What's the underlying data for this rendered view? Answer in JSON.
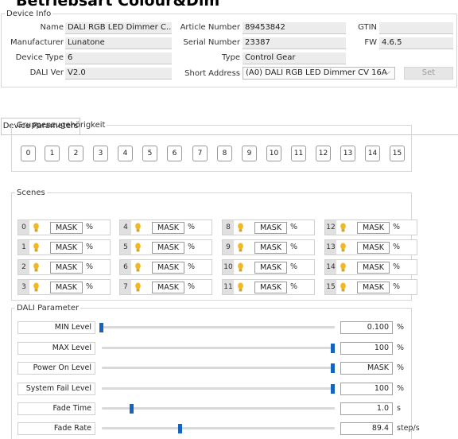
{
  "page_title": "Betriebsart Colour&Dim",
  "device_info": {
    "legend": "Device Info",
    "name_label": "Name",
    "name_value": "DALI RGB LED Dimmer C...",
    "manufacturer_label": "Manufacturer",
    "manufacturer_value": "Lunatone",
    "device_type_label": "Device Type",
    "device_type_value": "6",
    "dali_ver_label": "DALI Ver",
    "dali_ver_value": "V2.0",
    "article_label": "Article Number",
    "article_value": "89453842",
    "serial_label": "Serial Number",
    "serial_value": "23387",
    "type_label": "Type",
    "type_value": "Control Gear",
    "short_address_label": "Short Address",
    "short_address_value": "(A0) DALI RGB LED Dimmer CV 16A",
    "gtin_label": "GTIN",
    "gtin_value": "",
    "fw_label": "FW",
    "fw_value": "4.6.5",
    "set_button": "Set"
  },
  "tab": "Device Parameters",
  "groups": {
    "legend": "Gruppenzugehörigkeit",
    "buttons": [
      "0",
      "1",
      "2",
      "3",
      "4",
      "5",
      "6",
      "7",
      "8",
      "9",
      "10",
      "11",
      "12",
      "13",
      "14",
      "15"
    ]
  },
  "scenes": {
    "legend": "Scenes",
    "items": [
      {
        "num": "0",
        "value": "MASK",
        "unit": "%"
      },
      {
        "num": "1",
        "value": "MASK",
        "unit": "%"
      },
      {
        "num": "2",
        "value": "MASK",
        "unit": "%"
      },
      {
        "num": "3",
        "value": "MASK",
        "unit": "%"
      },
      {
        "num": "4",
        "value": "MASK",
        "unit": "%"
      },
      {
        "num": "5",
        "value": "MASK",
        "unit": "%"
      },
      {
        "num": "6",
        "value": "MASK",
        "unit": "%"
      },
      {
        "num": "7",
        "value": "MASK",
        "unit": "%"
      },
      {
        "num": "8",
        "value": "MASK",
        "unit": "%"
      },
      {
        "num": "9",
        "value": "MASK",
        "unit": "%"
      },
      {
        "num": "10",
        "value": "MASK",
        "unit": "%"
      },
      {
        "num": "11",
        "value": "MASK",
        "unit": "%"
      },
      {
        "num": "12",
        "value": "MASK",
        "unit": "%"
      },
      {
        "num": "13",
        "value": "MASK",
        "unit": "%"
      },
      {
        "num": "14",
        "value": "MASK",
        "unit": "%"
      },
      {
        "num": "15",
        "value": "MASK",
        "unit": "%"
      }
    ]
  },
  "dali_params": {
    "legend": "DALI Parameter",
    "rows": [
      {
        "label": "MIN Level",
        "value": "0.100",
        "unit": "%",
        "slider_level": 0.0
      },
      {
        "label": "MAX Level",
        "value": "100",
        "unit": "%",
        "slider_level": 1.0
      },
      {
        "label": "Power On Level",
        "value": "MASK",
        "unit": "%",
        "slider_level": 1.0
      },
      {
        "label": "System Fail Level",
        "value": "100",
        "unit": "%",
        "slider_level": 1.0
      },
      {
        "label": "Fade Time",
        "value": "1.0",
        "unit": "s",
        "slider_level": 0.13
      },
      {
        "label": "Fade Rate",
        "value": "89.4",
        "unit": "step/s",
        "slider_level": 0.34
      }
    ]
  },
  "colors": {
    "accent": "#1565c0",
    "field_bg": "#ececec",
    "bulb": "#f3b81e"
  }
}
